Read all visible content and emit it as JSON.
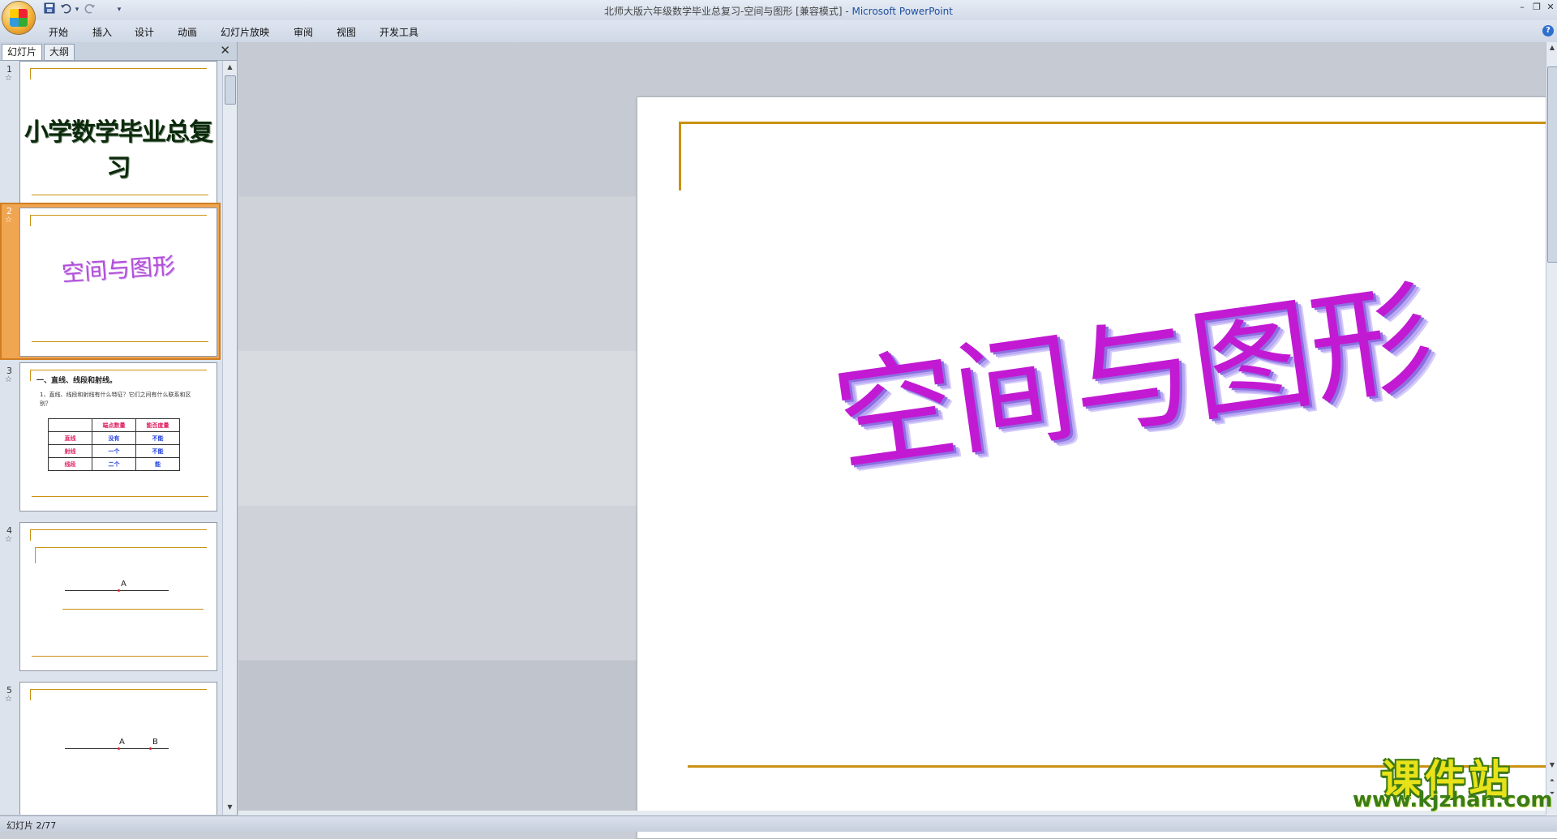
{
  "window": {
    "title_doc": "北师大版六年级数学毕业总复习-空间与图形 [兼容模式] - ",
    "title_app": "Microsoft PowerPoint"
  },
  "quick_access": {
    "icons": [
      "save-icon",
      "undo-icon",
      "redo-icon",
      "customize-icon"
    ],
    "undo_arrow": "▾",
    "customize": "▾"
  },
  "ribbon": {
    "tabs": [
      "开始",
      "插入",
      "设计",
      "动画",
      "幻灯片放映",
      "审阅",
      "视图",
      "开发工具"
    ],
    "help": "?"
  },
  "panel": {
    "tabs": [
      "幻灯片",
      "大纲"
    ],
    "close": "✕"
  },
  "thumbnails": [
    {
      "num": "1",
      "star": "☆",
      "title": "小学数学毕业总复习"
    },
    {
      "num": "2",
      "star": "☆",
      "title": "空间与图形"
    },
    {
      "num": "3",
      "star": "☆",
      "heading": "一、直线、线段和射线。",
      "question": "1、直线、线段和射线有什么特征？它们之间有什么联系和区别？",
      "table": {
        "headers": [
          "",
          "端点数量",
          "能否度量"
        ],
        "rows": [
          [
            "直线",
            "没有",
            "不能"
          ],
          [
            "射线",
            "一个",
            "不能"
          ],
          [
            "线段",
            "二个",
            "能"
          ]
        ]
      }
    },
    {
      "num": "4",
      "star": "☆",
      "point_a": "A"
    },
    {
      "num": "5",
      "star": "☆",
      "point_a": "A",
      "point_b": "B"
    }
  ],
  "slide": {
    "title": "空间与图形"
  },
  "status": {
    "text": "幻灯片 2/77"
  },
  "watermark": {
    "title": "课件站",
    "url": "www.kjzhan.com"
  },
  "colors": {
    "gold_line": "#c99214",
    "title_purple": "#c21ad3",
    "selected_thumb": "#f0a550"
  }
}
